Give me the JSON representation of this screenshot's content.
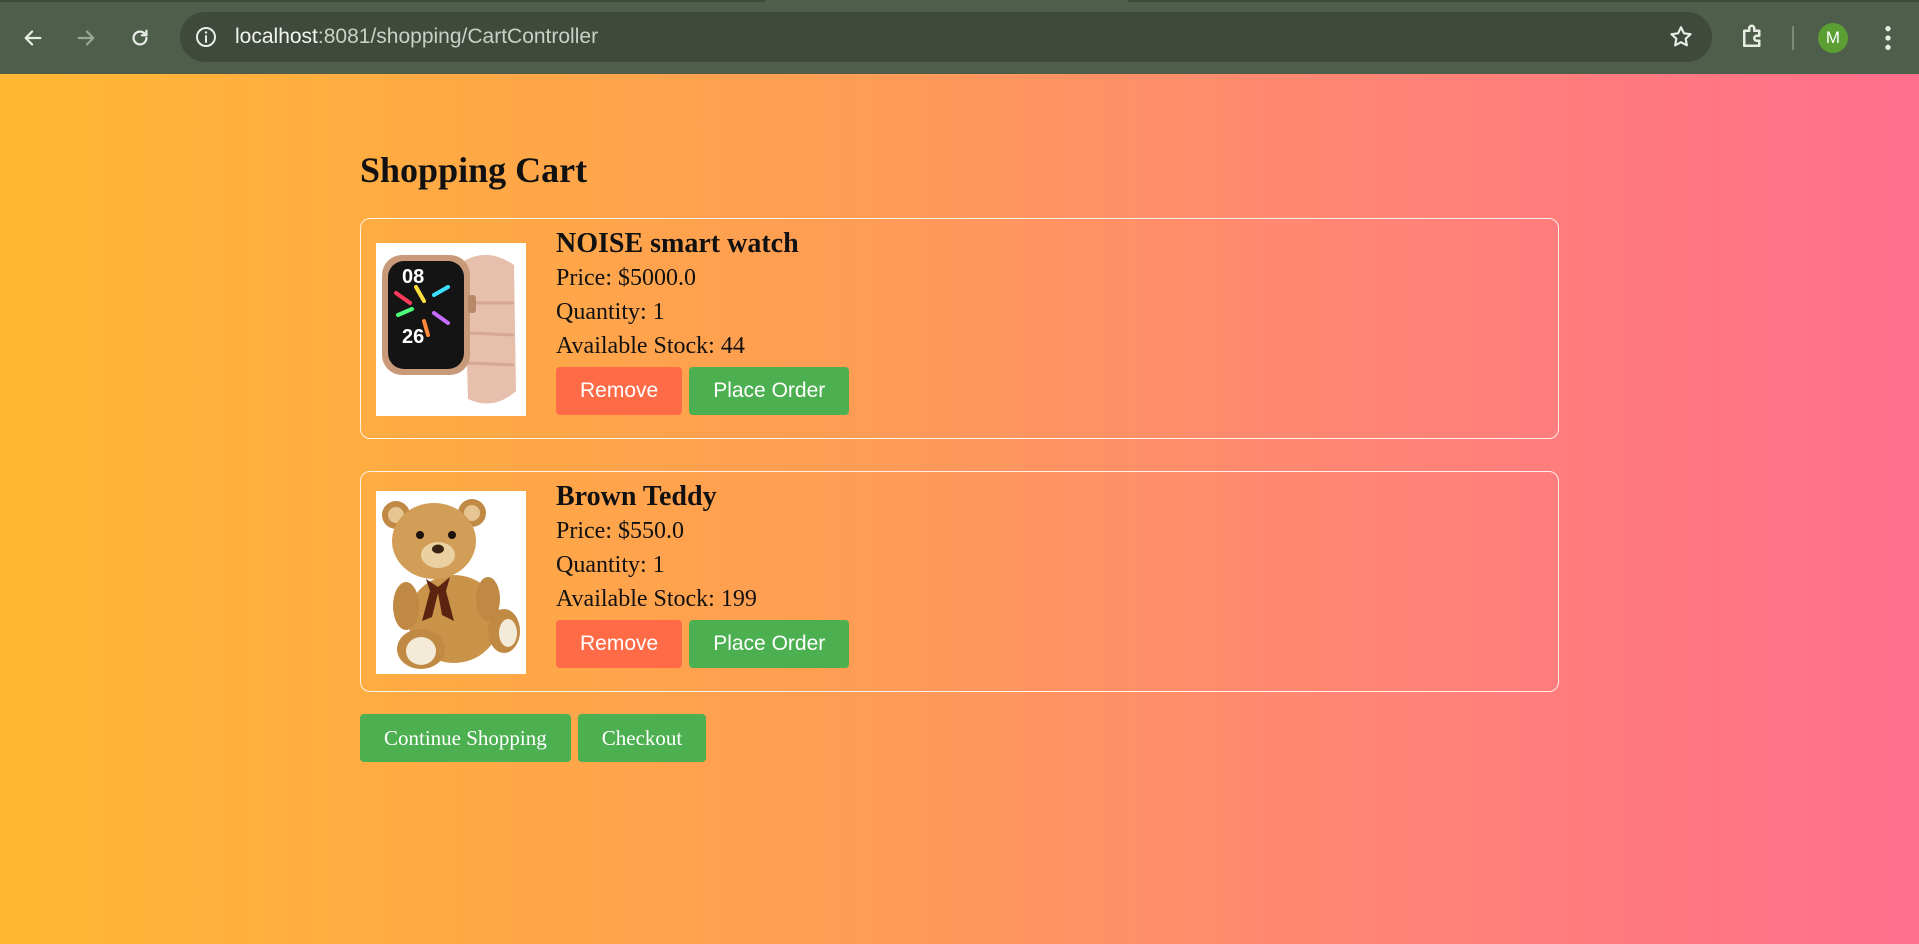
{
  "browser": {
    "url_host": "localhost",
    "url_path": ":8081/shopping/CartController",
    "profile_initial": "M",
    "icons": [
      "back-arrow-icon",
      "forward-arrow-icon",
      "reload-icon",
      "site-info-icon",
      "bookmark-star-icon",
      "extensions-puzzle-icon",
      "kebab-menu-icon"
    ]
  },
  "page": {
    "title": "Shopping Cart",
    "background_colors": [
      "#ffb833",
      "#ff9c55",
      "#ff6e8c"
    ]
  },
  "cart": {
    "items": [
      {
        "name": "NOISE smart watch",
        "price": "Price: $5000.0",
        "quantity": "Quantity: 1",
        "stock": "Available Stock: 44",
        "remove_label": "Remove",
        "order_label": "Place Order",
        "image": "smart-watch-image"
      },
      {
        "name": "Brown Teddy",
        "price": "Price: $550.0",
        "quantity": "Quantity: 1",
        "stock": "Available Stock: 199",
        "remove_label": "Remove",
        "order_label": "Place Order",
        "image": "teddy-bear-image"
      }
    ]
  },
  "actions": {
    "continue_label": "Continue Shopping",
    "checkout_label": "Checkout"
  },
  "colors": {
    "remove_button": "#ff6a47",
    "order_button": "#4caf50",
    "chrome": "#4f5e4b"
  }
}
